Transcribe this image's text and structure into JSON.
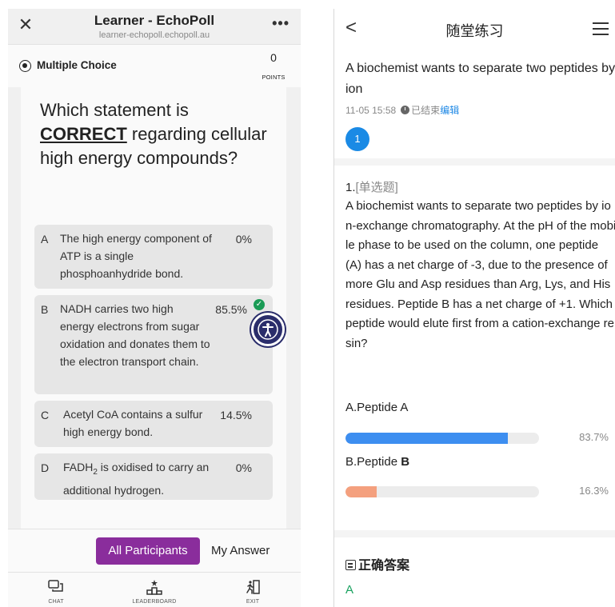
{
  "left": {
    "header": {
      "close": "✕",
      "title": "Learner - EchoPoll",
      "url": "learner-echopoll.echopoll.au",
      "more": "•••"
    },
    "question_bar": {
      "type": "Multiple Choice",
      "points_value": "0",
      "points_label": "POINTS"
    },
    "question": {
      "pre": "Which statement is",
      "emph": "CORRECT",
      "post": "regarding cellular high energy compounds?"
    },
    "options": [
      {
        "letter": "A",
        "text": "The high energy component of ATP is a single phosphoanhydride bond.",
        "pct": "0%"
      },
      {
        "letter": "B",
        "text": "NADH carries two high energy electrons from sugar oxidation and donates them to the electron transport chain.",
        "pct": "85.5%",
        "correct": true
      },
      {
        "letter": "C",
        "text": "Acetyl CoA contains a sulfur high energy bond.",
        "pct": "14.5%"
      },
      {
        "letter": "D",
        "text_pre": "FADH",
        "text_sub": "2",
        "text_post": " is oxidised to carry an additional hydrogen.",
        "pct": "0%"
      }
    ],
    "tabs": {
      "all": "All Participants",
      "mine": "My Answer"
    },
    "nav": [
      {
        "label": "CHAT",
        "icon": "chat-icon"
      },
      {
        "label": "LEADERBOARD",
        "icon": "leaderboard-icon"
      },
      {
        "label": "EXIT",
        "icon": "exit-icon"
      }
    ]
  },
  "right": {
    "nav": {
      "back": "<",
      "title": "随堂练习",
      "menu_icon": "menu-icon"
    },
    "header": {
      "title": "A biochemist wants to separate two peptides by ion",
      "timestamp": "11-05 15:58",
      "status": "已结束",
      "edit": "编辑",
      "badge": "1"
    },
    "question": {
      "number": "1.",
      "type": "[单选题]",
      "text": "A biochemist wants to separate two peptides by ion-exchange chromatography. At the pH of the mobile phase to be used on the column, one peptide (A) has a net charge of -3, due to the presence of more Glu and Asp residues than Arg, Lys, and His residues. Peptide B has a net charge of +1. Which peptide would elute first from a cation-exchange resin?"
    },
    "options": [
      {
        "label_pre": "A.Peptide ",
        "label_bold": "A",
        "pct": "83.7%",
        "value": 83.7,
        "color": "#3d8ef0"
      },
      {
        "label_pre": "B.Peptide ",
        "label_bold": "B",
        "pct": "16.3%",
        "value": 16.3,
        "color": "#f4a07e"
      }
    ],
    "answer": {
      "title": "正确答案",
      "value": "A"
    }
  }
}
